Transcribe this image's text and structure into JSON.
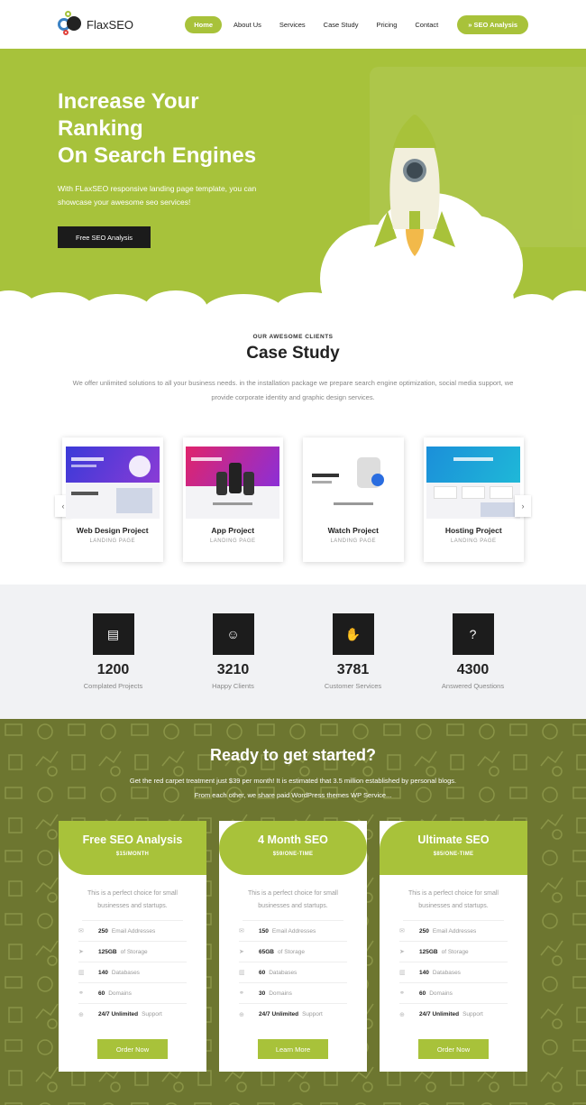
{
  "header": {
    "logo_text": "FlaxSEO",
    "nav": [
      {
        "label": "Home",
        "active": true
      },
      {
        "label": "About Us",
        "active": false
      },
      {
        "label": "Services",
        "active": false
      },
      {
        "label": "Case Study",
        "active": false
      },
      {
        "label": "Pricing",
        "active": false
      },
      {
        "label": "Contact",
        "active": false
      }
    ],
    "cta_label": "» SEO Analysis"
  },
  "hero": {
    "title_line1": "Increase Your",
    "title_line2": "Ranking",
    "title_line3": "On Search Engines",
    "subtitle": "With FLaxSEO responsive landing page template, you can showcase your awesome seo services!",
    "button_label": "Free SEO Analysis"
  },
  "case_study": {
    "eyebrow": "OUR AWESOME CLIENTS",
    "title": "Case Study",
    "description": "We offer unlimited solutions to all your business needs. in the installation package we prepare search engine optimization, social media support, we provide corporate identity and graphic design services.",
    "prev_icon": "‹",
    "next_icon": "›",
    "projects": [
      {
        "name": "Web Design Project",
        "sub": "LANDING PAGE"
      },
      {
        "name": "App Project",
        "sub": "LANDING PAGE"
      },
      {
        "name": "Watch Project",
        "sub": "LANDING PAGE"
      },
      {
        "name": "Hosting Project",
        "sub": "LANDING PAGE"
      }
    ]
  },
  "stats": [
    {
      "icon": "briefcase-icon",
      "glyph": "▤",
      "value": "1200",
      "label": "Complated Projects"
    },
    {
      "icon": "smiley-icon",
      "glyph": "☺",
      "value": "3210",
      "label": "Happy Clients"
    },
    {
      "icon": "support-icon",
      "glyph": "✋",
      "value": "3781",
      "label": "Customer Services"
    },
    {
      "icon": "question-icon",
      "glyph": "?",
      "value": "4300",
      "label": "Answered Questions"
    }
  ],
  "pricing": {
    "title": "Ready to get started?",
    "desc_line1": "Get the red carpet treatment just $39 per month! It is estimated that 3.5 million established by personal blogs.",
    "desc_line2": "From each other, we share paid WordPress themes WP Service...",
    "plans": [
      {
        "name": "Free SEO Analysis",
        "price": "$15/MONTH",
        "desc": "This is a perfect choice for small businesses and startups.",
        "features": [
          [
            "250",
            "Email Addresses"
          ],
          [
            "125GB",
            "of Storage"
          ],
          [
            "140",
            "Databases"
          ],
          [
            "60",
            "Domains"
          ],
          [
            "24/7 Unlimited",
            "Support"
          ]
        ],
        "button": "Order Now"
      },
      {
        "name": "4 Month SEO",
        "price": "$59/ONE-TIME",
        "desc": "This is a perfect choice for small businesses and startups.",
        "features": [
          [
            "150",
            "Email Addresses"
          ],
          [
            "65GB",
            "of Storage"
          ],
          [
            "60",
            "Databases"
          ],
          [
            "30",
            "Domains"
          ],
          [
            "24/7 Unlimited",
            "Support"
          ]
        ],
        "button": "Learn More"
      },
      {
        "name": "Ultimate SEO",
        "price": "$85/ONE-TIME",
        "desc": "This is a perfect choice for small businesses and startups.",
        "features": [
          [
            "250",
            "Email Addresses"
          ],
          [
            "125GB",
            "of Storage"
          ],
          [
            "140",
            "Databases"
          ],
          [
            "60",
            "Domains"
          ],
          [
            "24/7 Unlimited",
            "Support"
          ]
        ],
        "button": "Order Now"
      }
    ]
  },
  "colors": {
    "accent": "#a8c23a",
    "dark": "#1c1c1c",
    "olive": "#6d7630"
  }
}
